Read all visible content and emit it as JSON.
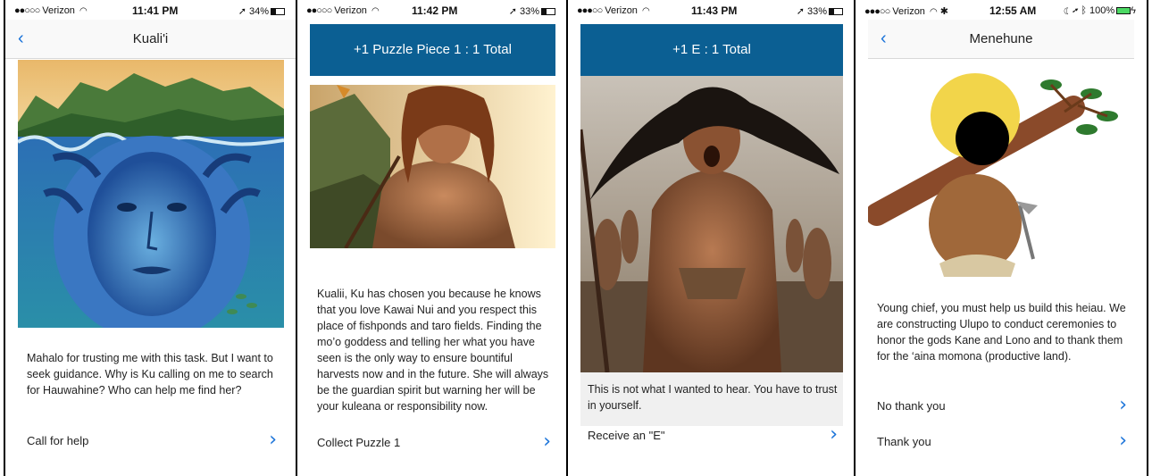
{
  "screens": [
    {
      "status": {
        "carrier": "Verizon",
        "time": "11:41 PM",
        "battery": "34%"
      },
      "nav": {
        "back_icon": "chevron-left-icon",
        "title": "Kuali'i"
      },
      "body": "Mahalo for trusting me with this task. But I want to seek guidance. Why is Ku calling on me to search for Hauwahine? Who can help me find her?",
      "choices": [
        {
          "label": "Call for help"
        }
      ]
    },
    {
      "status": {
        "carrier": "Verizon",
        "time": "11:42 PM",
        "battery": "33%"
      },
      "banner": "+1 Puzzle Piece 1 : 1 Total",
      "body": "Kualii, Ku has chosen you because he knows that you love Kawai Nui and you respect this place of fishponds and taro fields. Finding the mo’o goddess and telling her what you have seen is the only way to ensure bountiful harvests now and in the future. She will always be the guardian spirit but warning her will be your kuleana or responsibility now.",
      "choices": [
        {
          "label": "Collect Puzzle 1"
        }
      ]
    },
    {
      "status": {
        "carrier": "Verizon",
        "time": "11:43 PM",
        "battery": "33%"
      },
      "banner": "+1 E : 1 Total",
      "body": "This is not what I wanted to hear. You have to trust in yourself.",
      "choices": [
        {
          "label": "Receive an \"E\""
        }
      ]
    },
    {
      "status": {
        "carrier": "Verizon",
        "time": "12:55 AM",
        "battery": "100%"
      },
      "nav": {
        "back_icon": "chevron-left-icon",
        "title": "Menehune"
      },
      "body": "Young chief, you must help us build this heiau. We are constructing Ulupo to conduct ceremonies to honor the gods Kane and Lono and to thank them for the ‘aina momona (productive land).",
      "choices": [
        {
          "label": "No thank you"
        },
        {
          "label": "Thank you"
        }
      ]
    }
  ],
  "colors": {
    "banner": "#0b5f93",
    "accent": "#1a73d9",
    "battery_charging": "#4cd964"
  },
  "icons": {
    "chevron": "›",
    "back": "‹"
  }
}
